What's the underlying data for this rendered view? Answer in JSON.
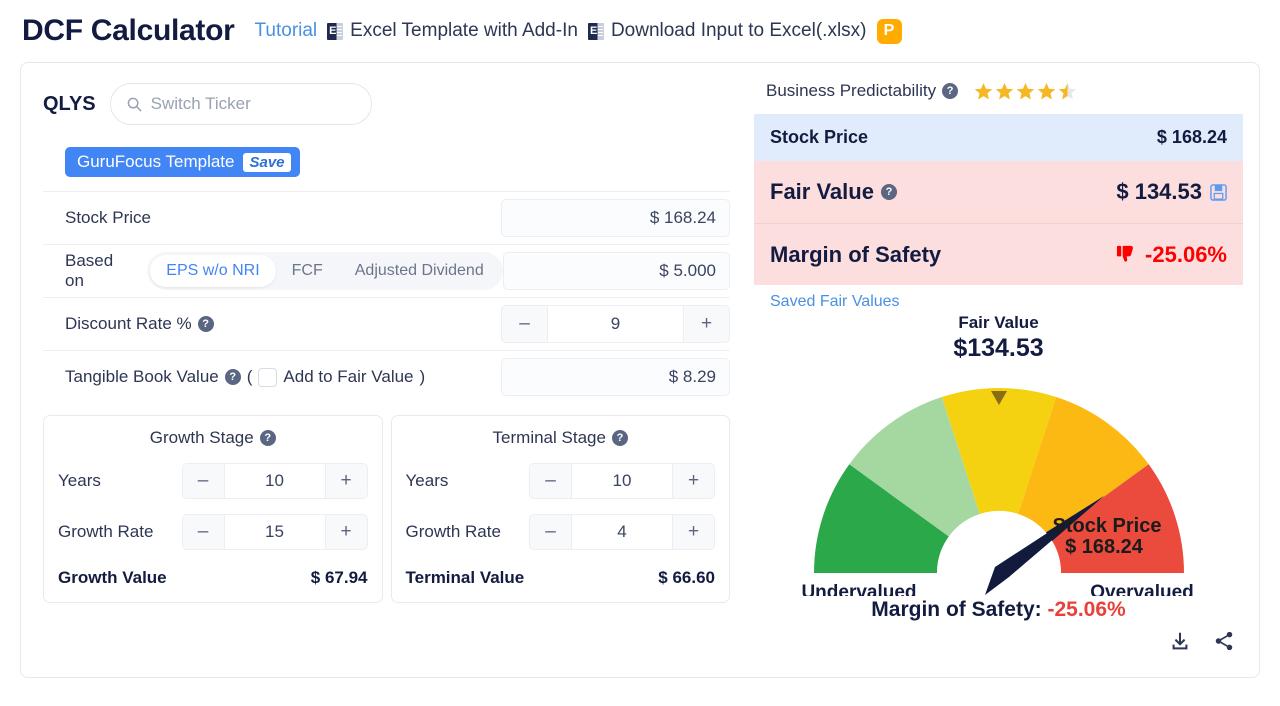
{
  "header": {
    "title": "DCF Calculator",
    "tutorial": "Tutorial",
    "excel_template": "Excel Template with Add-In",
    "download_input": "Download Input to Excel(.xlsx)",
    "premium_badge": "P",
    "excel_icon": "excel-file-icon"
  },
  "left": {
    "ticker": "QLYS",
    "search_placeholder": "Switch Ticker",
    "template_name": "GuruFocus Template",
    "template_save": "Save",
    "stock_price_label": "Stock Price",
    "stock_price_value": "$ 168.24",
    "based_on_label": "Based on",
    "based_on_options": [
      "EPS w/o NRI",
      "FCF",
      "Adjusted Dividend"
    ],
    "based_on_selected": "EPS w/o NRI",
    "based_on_value": "$ 5.000",
    "discount_rate_label": "Discount Rate %",
    "discount_rate_value": "9",
    "tangible_label": "Tangible Book Value",
    "tangible_paren_open": "(",
    "tangible_checkbox_label": "Add to Fair Value",
    "tangible_paren_close": ")",
    "tangible_value": "$ 8.29",
    "minus": "–",
    "plus": "+",
    "help": "?",
    "growth_stage": {
      "title": "Growth Stage",
      "years_label": "Years",
      "years_value": "10",
      "rate_label": "Growth Rate",
      "rate_value": "15",
      "total_label": "Growth Value",
      "total_value": "$ 67.94"
    },
    "terminal_stage": {
      "title": "Terminal Stage",
      "years_label": "Years",
      "years_value": "10",
      "rate_label": "Growth Rate",
      "rate_value": "4",
      "total_label": "Terminal Value",
      "total_value": "$ 66.60"
    }
  },
  "right": {
    "predictability_label": "Business Predictability",
    "predictability_stars": 4.5,
    "stock_price_label": "Stock Price",
    "stock_price_value": "$ 168.24",
    "fair_value_label": "Fair Value",
    "fair_value_value": "$ 134.53",
    "margin_label": "Margin of Safety",
    "margin_value": "-25.06%",
    "saved_link": "Saved Fair Values",
    "save_icon": "floppy-save-icon",
    "thumbs_down_icon": "thumbs-down-icon",
    "download_icon": "download-icon",
    "share_icon": "share-icon"
  },
  "chart_data": {
    "type": "gauge",
    "title": "Fair Value",
    "title_value": "$134.53",
    "needle_label_line1": "Stock Price",
    "needle_label_line2": "$ 168.24",
    "left_label": "Undervalued",
    "right_label": "Overvalued",
    "footer_label": "Margin of Safety:",
    "footer_value": "-25.06%",
    "fair_value": 134.53,
    "stock_price": 168.24,
    "margin_of_safety_pct": -25.06,
    "marker_angle_deg": 90,
    "needle_angle_deg": 36,
    "segments": [
      {
        "name": "deep-undervalued",
        "color": "#2ba84a",
        "start_deg": 180,
        "end_deg": 144
      },
      {
        "name": "undervalued",
        "color": "#a4d8a0",
        "start_deg": 144,
        "end_deg": 108
      },
      {
        "name": "fair",
        "color": "#f5d211",
        "start_deg": 108,
        "end_deg": 72
      },
      {
        "name": "overvalued",
        "color": "#fcb813",
        "start_deg": 72,
        "end_deg": 36
      },
      {
        "name": "deep-overvalued",
        "color": "#ea4b3c",
        "start_deg": 36,
        "end_deg": 0
      }
    ]
  }
}
